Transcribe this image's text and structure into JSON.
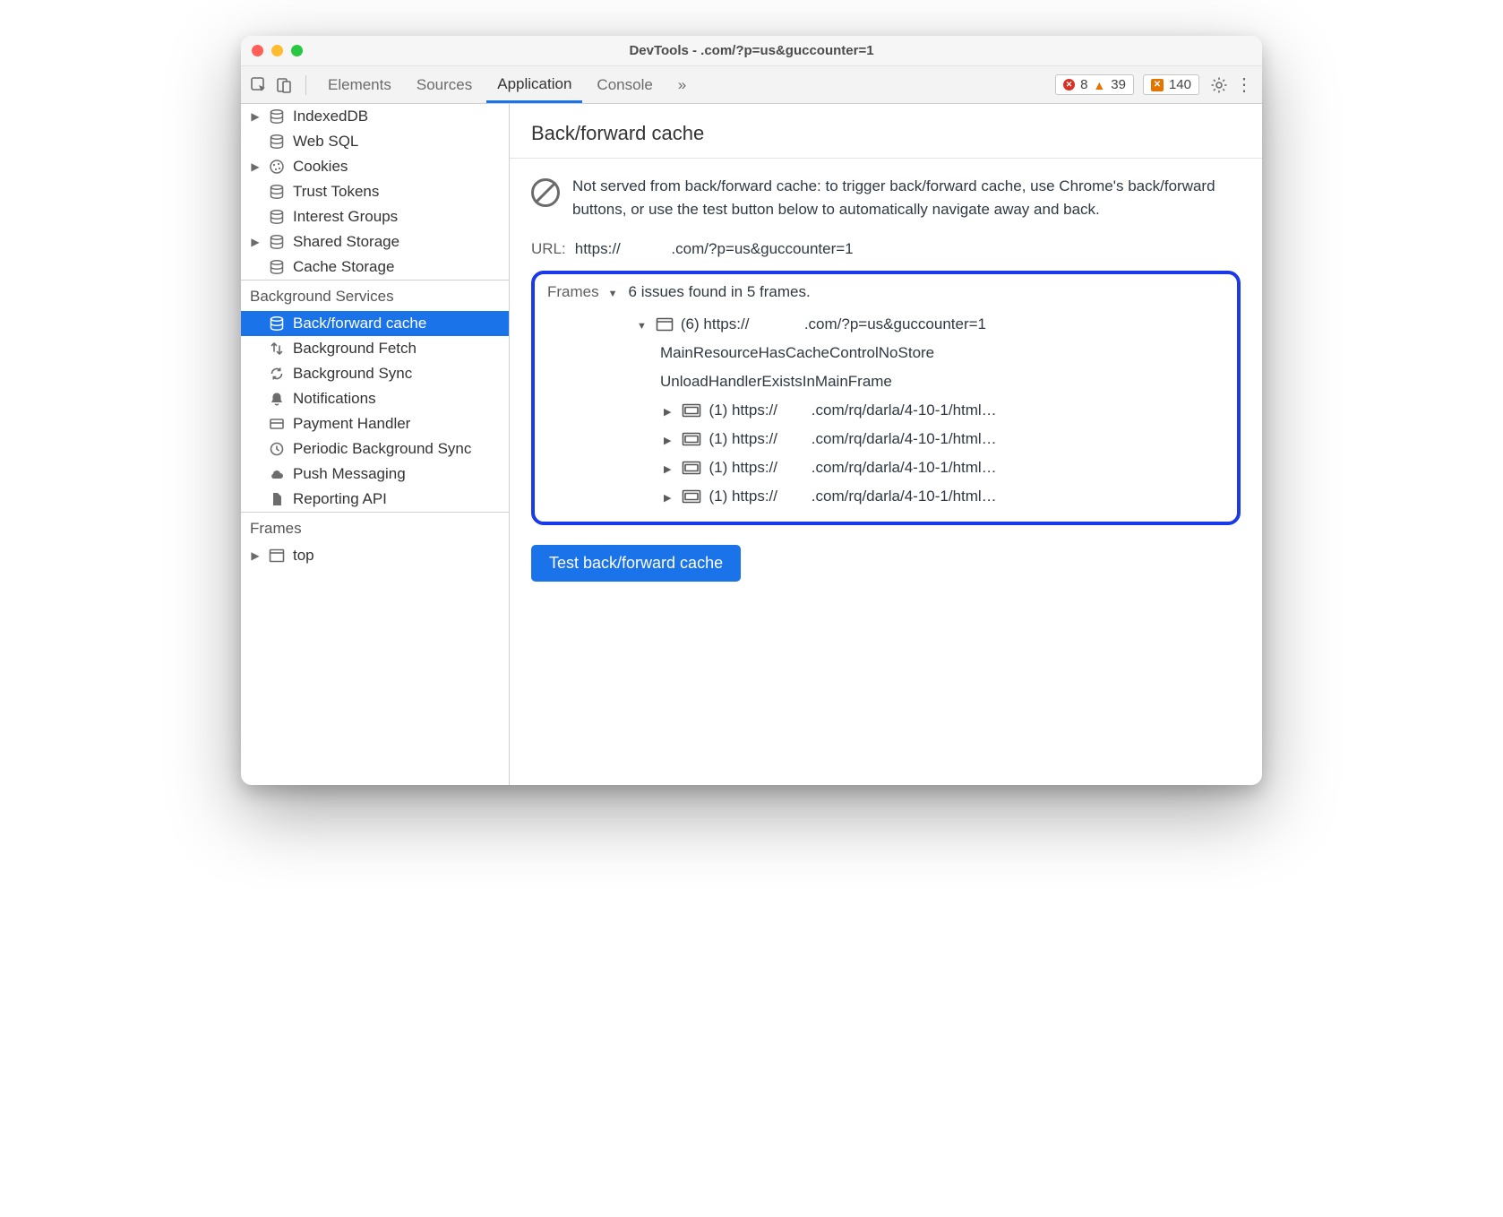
{
  "window": {
    "title": "DevTools -          .com/?p=us&guccounter=1"
  },
  "tabs": {
    "items": [
      "Elements",
      "Sources",
      "Application",
      "Console"
    ],
    "more_label": "»",
    "active": "Application"
  },
  "toolbar": {
    "errors": "8",
    "warnings": "39",
    "issues": "140"
  },
  "sidebar": {
    "storage": [
      {
        "label": "IndexedDB",
        "icon": "db",
        "expandable": true
      },
      {
        "label": "Web SQL",
        "icon": "db",
        "expandable": false
      },
      {
        "label": "Cookies",
        "icon": "cookie",
        "expandable": true
      },
      {
        "label": "Trust Tokens",
        "icon": "db",
        "expandable": false
      },
      {
        "label": "Interest Groups",
        "icon": "db",
        "expandable": false
      },
      {
        "label": "Shared Storage",
        "icon": "db",
        "expandable": true
      },
      {
        "label": "Cache Storage",
        "icon": "db",
        "expandable": false
      }
    ],
    "bg_title": "Background Services",
    "bg": [
      {
        "label": "Back/forward cache",
        "icon": "db",
        "active": true
      },
      {
        "label": "Background Fetch",
        "icon": "arrows"
      },
      {
        "label": "Background Sync",
        "icon": "sync"
      },
      {
        "label": "Notifications",
        "icon": "bell"
      },
      {
        "label": "Payment Handler",
        "icon": "card"
      },
      {
        "label": "Periodic Background Sync",
        "icon": "clock"
      },
      {
        "label": "Push Messaging",
        "icon": "cloud"
      },
      {
        "label": "Reporting API",
        "icon": "doc"
      }
    ],
    "frames_title": "Frames",
    "frames_root": "top"
  },
  "panel": {
    "title": "Back/forward cache",
    "banner": "Not served from back/forward cache: to trigger back/forward cache, use Chrome's back/forward buttons, or use the test button below to automatically navigate away and back.",
    "url_key": "URL:",
    "url_val": "https://            .com/?p=us&guccounter=1",
    "frames_key": "Frames",
    "frames_summary": "6 issues found in 5 frames.",
    "root_label": "(6) https://             .com/?p=us&guccounter=1",
    "reasons": [
      "MainResourceHasCacheControlNoStore",
      "UnloadHandlerExistsInMainFrame"
    ],
    "children": [
      "(1) https://        .com/rq/darla/4-10-1/html…",
      "(1) https://        .com/rq/darla/4-10-1/html…",
      "(1) https://        .com/rq/darla/4-10-1/html…",
      "(1) https://        .com/rq/darla/4-10-1/html…"
    ],
    "test_btn": "Test back/forward cache"
  }
}
